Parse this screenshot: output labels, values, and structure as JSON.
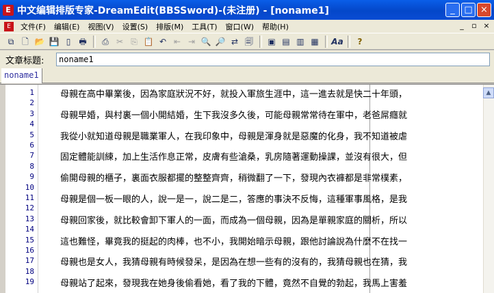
{
  "window": {
    "title": "中文编辑排版专家-DreamEdit(BBSSword)-(未注册) - [noname1]",
    "buttons": [
      "_",
      "□",
      "×"
    ]
  },
  "menu": {
    "items": [
      "文件(F)",
      "编辑(E)",
      "视图(V)",
      "设置(S)",
      "排版(M)",
      "工具(T)",
      "窗口(W)",
      "帮助(H)"
    ],
    "mdi_buttons": [
      "_",
      "▫",
      "×"
    ]
  },
  "toolbar": {
    "icons": [
      "windows-icon",
      "new-doc-icon",
      "open-folder-icon",
      "save-icon",
      "bookmark-icon",
      "print-icon",
      "file-icon",
      "cut-icon",
      "copy-icon",
      "paste-icon",
      "undo-icon",
      "outdent-icon",
      "indent-icon",
      "find-icon",
      "find-next-icon",
      "replace-icon",
      "clipboard-icon",
      "view-icon",
      "layout-icon",
      "format-icon",
      "columns-icon",
      "font-icon",
      "help-icon"
    ],
    "glyphs": [
      "⧉",
      "🗋",
      "📂",
      "💾",
      "▯",
      "🖶",
      "⎙",
      "✂",
      "⎘",
      "📋",
      "↶",
      "⇤",
      "⇥",
      "🔍",
      "🔎",
      "⇄",
      "🗐",
      "▣",
      "▤",
      "▥",
      "▦",
      "Aa",
      "?"
    ]
  },
  "article": {
    "label": "文章标题:",
    "value": "noname1"
  },
  "tab": {
    "label": "noname1"
  },
  "editor": {
    "line_numbers": [
      "1",
      "2",
      "3",
      "4",
      "5",
      "6",
      "7",
      "8",
      "9",
      "10",
      "11",
      "12",
      "13",
      "14",
      "15",
      "16",
      "17",
      "18",
      "19"
    ],
    "lines": [
      "母親在高中畢業後，因為家庭狀況不好，就投入軍旅生涯中，這一進去就是快二十年頭，",
      "母親早婚，與村裏一個小開結婚，生下我沒多久後，可能母親常常待在軍中，老爸屌癮就",
      "我從小就知道母親是職業軍人，在我印象中，母親是渾身就是惡魔的化身，我不知道被虐",
      "固定體能訓練，加上生活作息正常，皮膚有些滄桑，乳房隨著運動操課，並沒有很大，但",
      "偷開母親的櫃子，裏面衣服都擺的整整齊齊，稍微翻了一下，發現內衣褲都是非常樸素，",
      "母親是個一板一眼的人，說一是一，說二是二，答應的事決不反悔，這種軍事風格，是我",
      "母親回家後，就比較會卸下軍人的一面，而成為一個母親，因為是單親家庭的關析，所以",
      "這也難怪，畢竟我的挺起的肉棒，也不小，我開始暗示母親，跟他討論說為什麼不在找一",
      "母親也是女人，我猜母親有時候發呆，是因為在想一些有的沒有的，我猜母親也在猜，我",
      "母親站了起來，發現我在她身後偷看她，看了我的下體，竟然不自覺的勃起，我馬上害羞"
    ]
  },
  "colors": {
    "title_bar": "#0447c9",
    "face": "#ece9d8",
    "line_numbers": "#000080",
    "tab_text": "#3030a0"
  }
}
